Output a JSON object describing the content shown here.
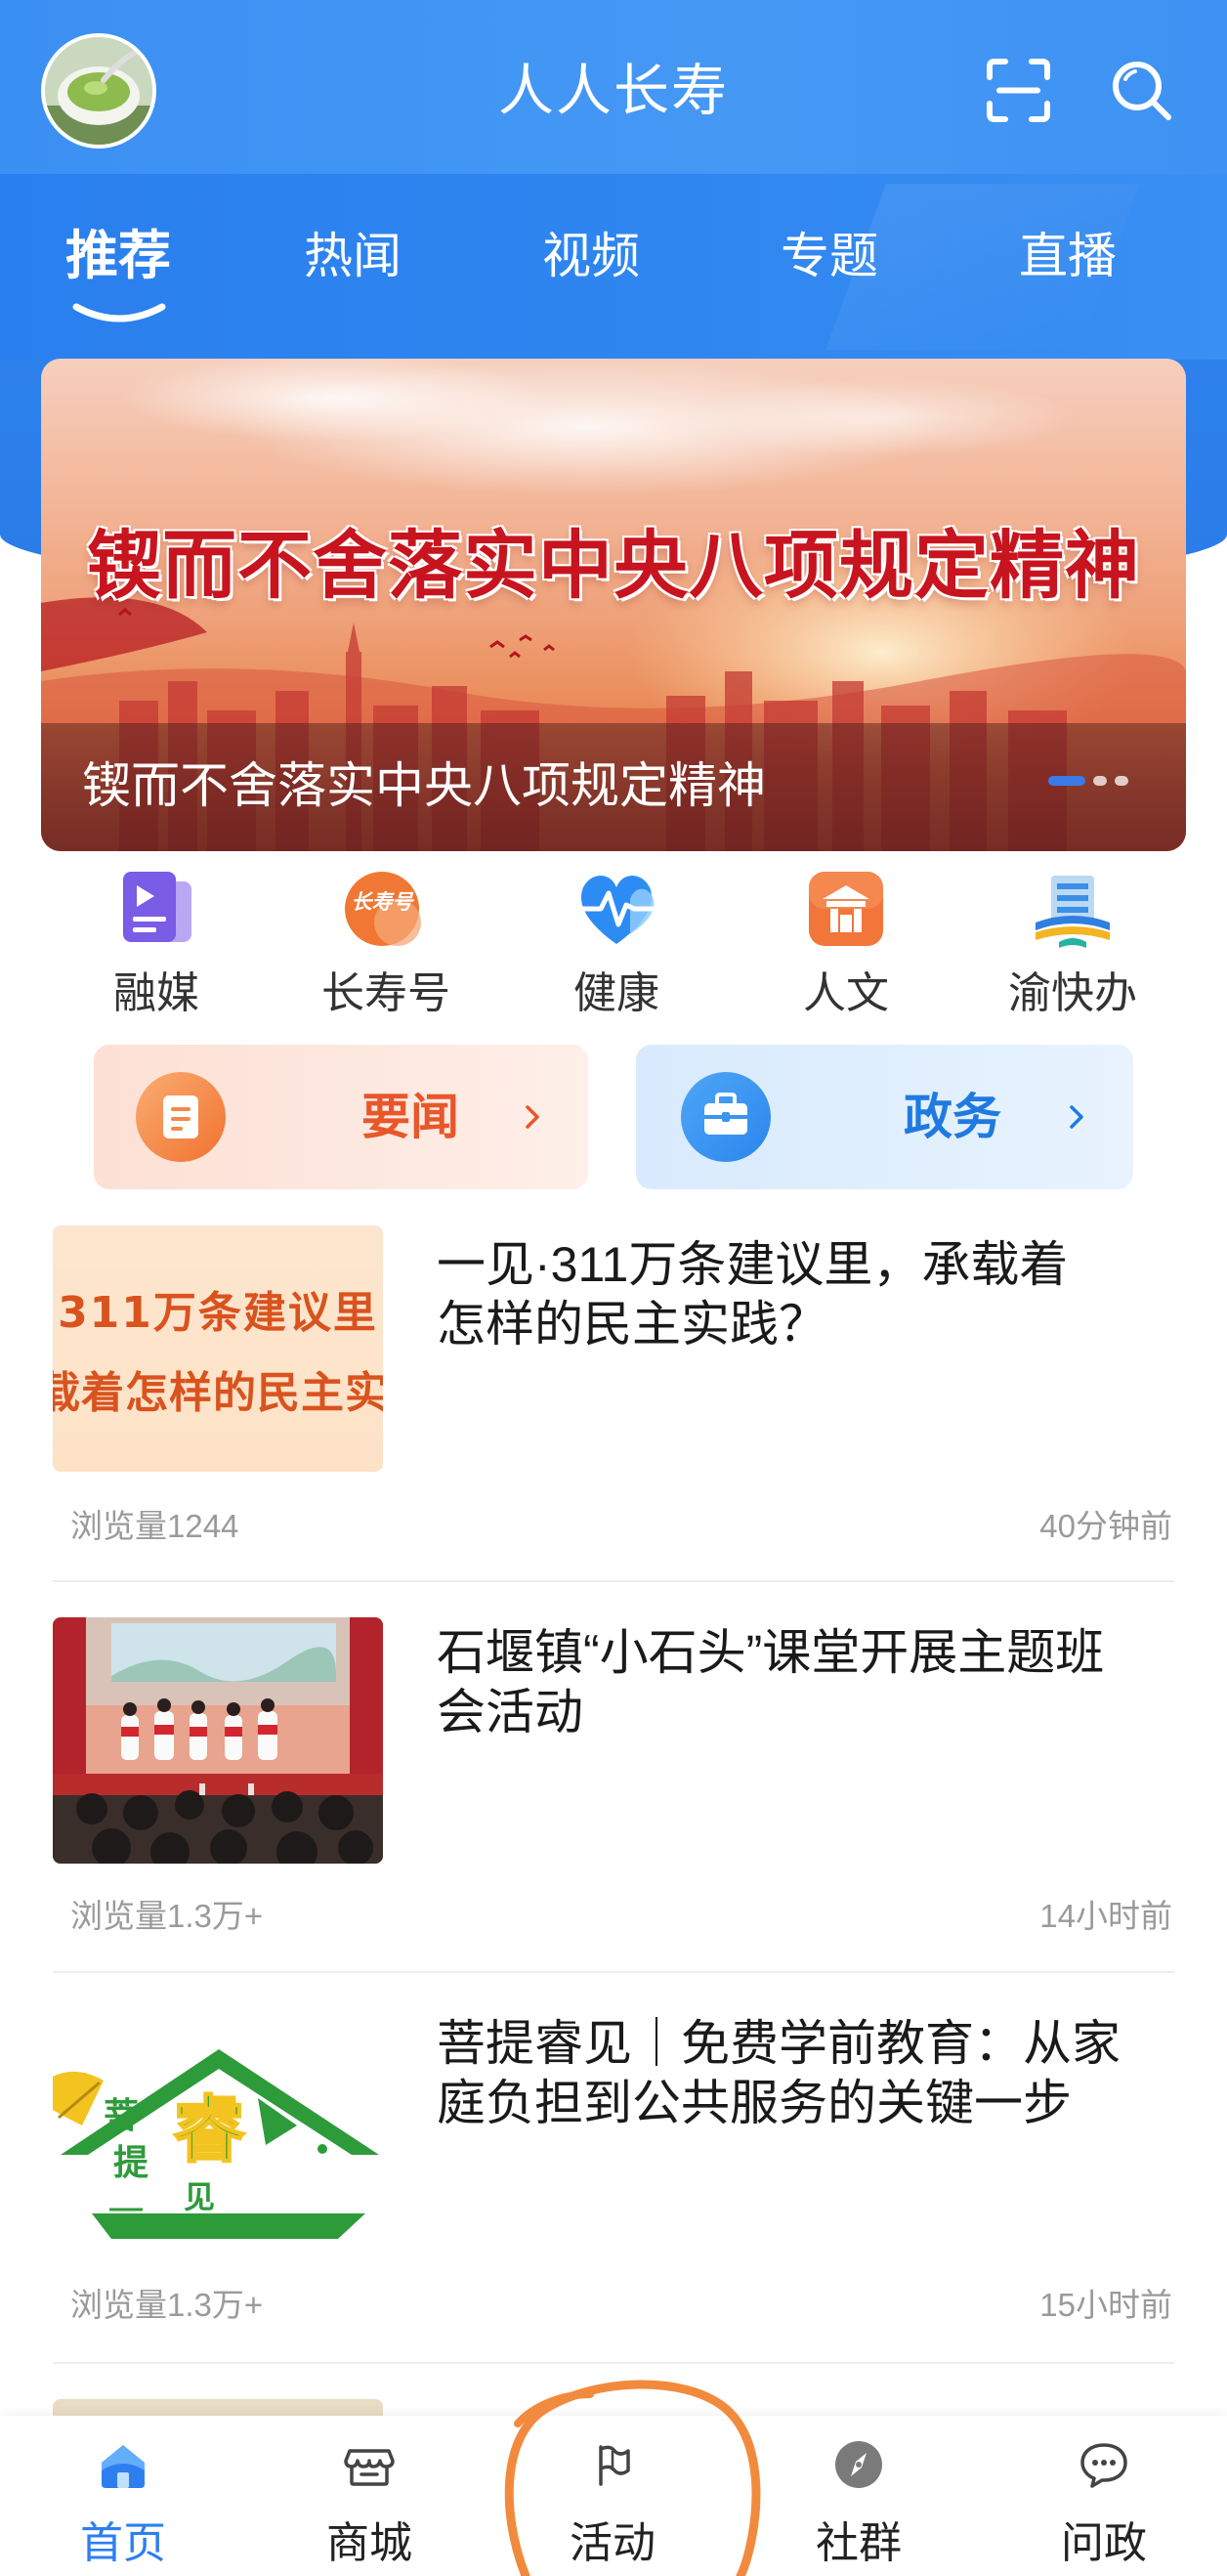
{
  "header": {
    "title": "人人长寿",
    "avatar": "avatar",
    "scan_icon": "scan-icon",
    "search_icon": "search-icon"
  },
  "tabs": [
    {
      "label": "推荐",
      "active": true
    },
    {
      "label": "热闻",
      "active": false
    },
    {
      "label": "视频",
      "active": false
    },
    {
      "label": "专题",
      "active": false
    },
    {
      "label": "直播",
      "active": false
    }
  ],
  "banner": {
    "headline": "锲而不舍落实中央八项规定精神",
    "caption": "锲而不舍落实中央八项规定精神",
    "slides": 3,
    "active_slide": 0
  },
  "quick_links": [
    {
      "label": "融媒",
      "icon": "media-icon"
    },
    {
      "label": "长寿号",
      "icon": "changshouhao-logo-icon",
      "logo_text": "长寿号"
    },
    {
      "label": "健康",
      "icon": "heart-pulse-icon"
    },
    {
      "label": "人文",
      "icon": "pavilion-icon"
    },
    {
      "label": "渝快办",
      "icon": "yukuaiban-icon"
    }
  ],
  "feature_cards": [
    {
      "label": "要闻",
      "icon": "document-icon",
      "color": "#e8562a"
    },
    {
      "label": "政务",
      "icon": "briefcase-icon",
      "color": "#1f7ae0"
    }
  ],
  "news": [
    {
      "title_lines": [
        "一见·311万条建议里，承载着",
        "怎样的民主实践？"
      ],
      "views": "浏览量1244",
      "time": "40分钟前",
      "thumb_text": [
        "311万条建议里",
        "载着怎样的民主实"
      ]
    },
    {
      "title_lines": [
        "石堰镇“小石头”课堂开展主题班",
        "会活动"
      ],
      "views": "浏览量1.3万+",
      "time": "14小时前"
    },
    {
      "title_lines": [
        "菩提睿见｜免费学前教育：从家",
        "庭负担到公共服务的关键一步"
      ],
      "views": "浏览量1.3万+",
      "time": "15小时前",
      "logo_text": [
        "菩",
        "提",
        "睿",
        "见"
      ]
    }
  ],
  "bottom_nav": [
    {
      "label": "首页",
      "icon": "home-icon",
      "active": true
    },
    {
      "label": "商城",
      "icon": "store-icon",
      "active": false
    },
    {
      "label": "活动",
      "icon": "flag-icon",
      "active": false
    },
    {
      "label": "社群",
      "icon": "compass-icon",
      "active": false
    },
    {
      "label": "问政",
      "icon": "chat-icon",
      "active": false
    }
  ],
  "colors": {
    "brand_blue": "#2d7ff0",
    "headline_red": "#c8141e",
    "news_orange": "#e8562a",
    "gov_blue": "#1f7ae0",
    "annotation_orange": "#f28a3d"
  }
}
